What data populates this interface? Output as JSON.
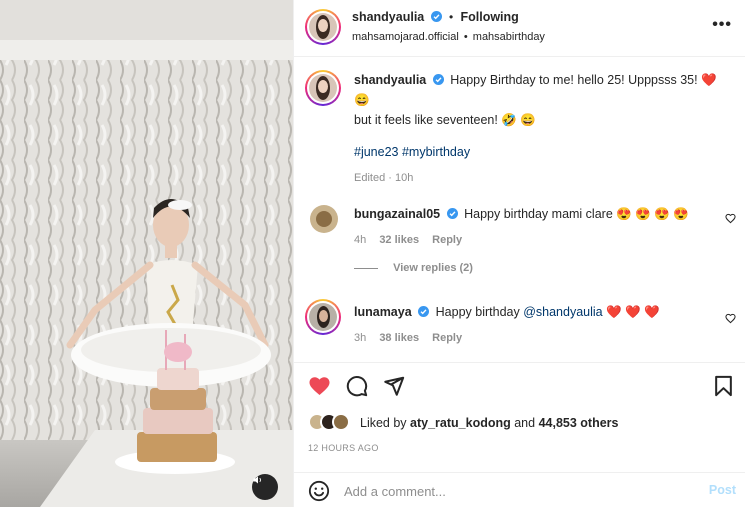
{
  "post": {
    "author": "shandyaulia",
    "follow_status": "Following",
    "separator": "•",
    "collab": "mahsamojarad.official",
    "audio": "mahsabirthday",
    "more_label": "•••"
  },
  "caption": {
    "username": "shandyaulia",
    "line1": "Happy Birthday to me! hello 25! Upppsss 35! ❤️",
    "line1b": "😄",
    "line2": "but it feels like seventeen! 🤣 😄",
    "hashtag1": "#june23",
    "hashtag2": "#mybirthday",
    "edited": "Edited · 10h"
  },
  "comments": [
    {
      "username": "bungazainal05",
      "text": "Happy birthday mami clare 😍 😍 😍 😍",
      "time": "4h",
      "likes": "32 likes",
      "reply_label": "Reply",
      "view_replies": "View replies (2)"
    },
    {
      "username": "lunamaya",
      "text_prefix": "Happy birthday ",
      "mention": "@shandyaulia",
      "text_suffix": " ❤️ ❤️ ❤️",
      "time": "3h",
      "likes": "38 likes",
      "reply_label": "Reply"
    }
  ],
  "likes": {
    "prefix": "Liked by ",
    "user": "aty_ratu_kodong",
    "middle": " and ",
    "count": "44,853 others"
  },
  "timestamp": "12 HOURS AGO",
  "composer": {
    "placeholder": "Add a comment...",
    "post_label": "Post"
  },
  "colors": {
    "like_red": "#ed4956",
    "link_blue": "#00376b",
    "verified_blue": "#3897f0",
    "post_disabled": "#b2dffc"
  },
  "icons": {
    "verified": "verified-badge-icon",
    "like": "heart-filled-icon",
    "comment": "comment-bubble-icon",
    "share": "paper-plane-icon",
    "save": "bookmark-icon",
    "emoji": "smiley-icon",
    "audio": "speaker-icon"
  }
}
